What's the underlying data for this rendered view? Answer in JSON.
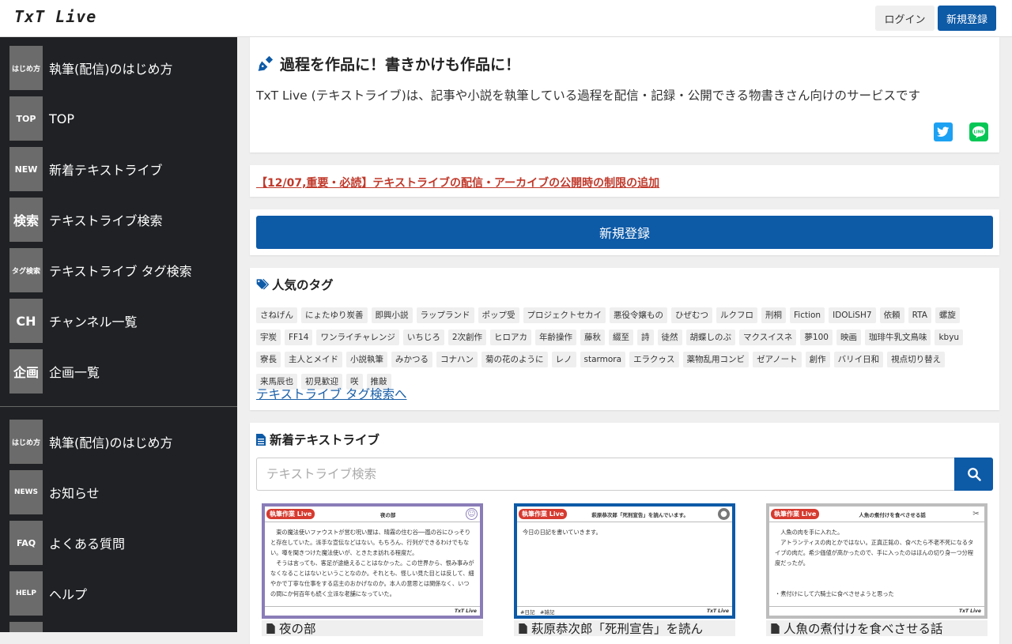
{
  "header": {
    "logo": "TxT Live",
    "login_label": "ログイン",
    "signup_label": "新規登録"
  },
  "sidebar": {
    "primary": [
      {
        "badge": "はじめ方",
        "label": "執筆(配信)のはじめ方"
      },
      {
        "badge": "TOP",
        "label": "TOP"
      },
      {
        "badge": "NEW",
        "label": "新着テキストライブ"
      },
      {
        "badge": "検索",
        "label": "テキストライブ検索"
      },
      {
        "badge": "タグ検索",
        "label": "テキストライブ タグ検索"
      },
      {
        "badge": "CH",
        "label": "チャンネル一覧"
      },
      {
        "badge": "企画",
        "label": "企画一覧"
      }
    ],
    "secondary": [
      {
        "badge": "はじめ方",
        "label": "執筆(配信)のはじめ方"
      },
      {
        "badge": "NEWS",
        "label": "お知らせ"
      },
      {
        "badge": "FAQ",
        "label": "よくある質問"
      },
      {
        "badge": "HELP",
        "label": "ヘルプ"
      }
    ]
  },
  "hero": {
    "title": "過程を作品に！書きかけも作品に！",
    "description": "TxT Live (テキストライブ)は、記事や小説を執筆している過程を配信・記録・公開できる物書きさん向けのサービスです"
  },
  "notice": {
    "text": "【12/07,重要・必読】テキストライブの配信・アーカイブの公開時の制限の追加"
  },
  "signup_banner": {
    "label": "新規登録"
  },
  "popular_tags": {
    "title": "人気のタグ",
    "tags": [
      "さねげん",
      "にょたゆり炭善",
      "即興小説",
      "ラップランド",
      "ポップ受",
      "プロジェクトセカイ",
      "悪役令嬢もの",
      "ひぜむつ",
      "ルクフロ",
      "刑桐",
      "Fiction",
      "IDOLiSH7",
      "依頼",
      "RTA",
      "螺旋",
      "宇炭",
      "FF14",
      "ワンライチャレンジ",
      "いちじろ",
      "2次創作",
      "ヒロアカ",
      "年齢操作",
      "藤秋",
      "綴至",
      "詩",
      "徒然",
      "胡蝶しのぶ",
      "マクスイスネ",
      "夢100",
      "映画",
      "珈琲牛乳文鳥味",
      "kbyu",
      "寮長",
      "主人とメイド",
      "小説執筆",
      "みかつる",
      "コナハン",
      "菊の花のように",
      "レノ",
      "starmora",
      "エラクゥス",
      "薬物乱用コンビ",
      "ゼアノート",
      "創作",
      "バリイ日和",
      "視点切り替え",
      "来馬辰也",
      "初見歓迎",
      "咲",
      "推敲"
    ],
    "link_label": "テキストライブ タグ検索へ"
  },
  "new_live": {
    "title": "新着テキストライブ",
    "search_placeholder": "テキストライブ検索",
    "items": [
      {
        "badge": "執筆作業 Live",
        "head_title": "夜の部",
        "body": "　東の魔法使いファウストが営む呪い屋は、晴霧の住む谷──嵐の谷にひっそりと存在していた。派手な宣伝などはない。もちろん、行列ができるわけでもない。噂を聞きつけた魔法使いが、ときたま訪れる程度だ。\n　そうは言っても、客足が途絶えることはなかった。この世界から、恨み事みがなくなることはないということなのか。それとも、怪しい見た目とは反して、細やかで丁寧な仕事をする店主のおかげなのか。本人の意思とは関係なく、いつの間にか何百年も続く立派な老舗になっていた。",
        "foot_tags": "",
        "brand": "TxT Live",
        "border_color": "#8a7cb8",
        "caption": "夜の部"
      },
      {
        "badge": "執筆作業 Live",
        "head_title": "萩原恭次郎「死刑宣告」を読んでいます。",
        "body": "今日の日記を書いていきます。",
        "foot_tags": "#日記　#雑記",
        "brand": "TxT Live",
        "border_color": "#0d5aa7",
        "caption": "萩原恭次郎「死刑宣告」を読ん"
      },
      {
        "badge": "執筆作業 Live",
        "head_title": "人魚の煮付けを食べさせる話",
        "body": "　人魚の肉を手に入れた。\n　アトランティスの肉とかではない。正真正銘の、食べたら不老不死になるタイプの肉だ。希少価値が高かったので、手に入ったのはほんの切り身一つ分程度だったが。\n\n\n・煮付けにして六騎士に食べさせようと思った",
        "foot_tags": "",
        "brand": "TxT Live",
        "border_color": "#bdbdbd",
        "caption": "人魚の煮付けを食べさせる話"
      }
    ]
  },
  "colors": {
    "primary": "#0d5aa7",
    "sidebar_bg": "#1f2124",
    "badge_bg": "#6b6b6b",
    "notice": "#c0392b",
    "twitter": "#1da1f2",
    "line": "#06c755"
  },
  "icons": {
    "hero": "pen-nib-icon",
    "tags": "tags-icon",
    "new_live": "file-icon",
    "search": "search-icon",
    "share_twitter": "twitter-icon",
    "share_line": "line-icon"
  }
}
